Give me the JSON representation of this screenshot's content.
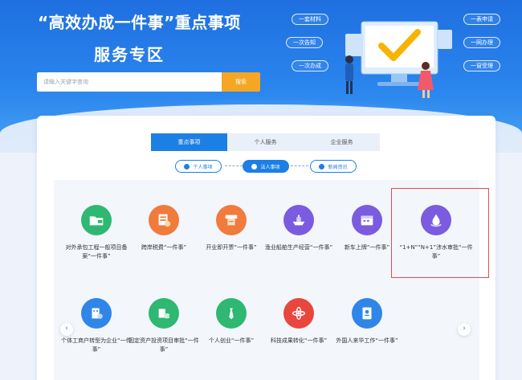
{
  "banner": {
    "title_line1": "“高效办成一件事”重点事项",
    "title_line2": "服务专区",
    "tags": [
      "一套材料",
      "一次告知",
      "一次办成",
      "一表申请",
      "一网办理",
      "一窗受理"
    ]
  },
  "search": {
    "placeholder": "请输入关键字查询",
    "button_label": "搜索"
  },
  "tabs": [
    "重点事项",
    "个人服务",
    "企业服务"
  ],
  "sub_filters": [
    "个人事项",
    "法人事项",
    "新闻资讯"
  ],
  "items": [
    {
      "label": "对外承包工程一般项目备案“一件事”",
      "color": "#2eb872",
      "icon": "folder-icon"
    },
    {
      "label": "跨岸税费“一件事”",
      "color": "#f07b3c",
      "icon": "tax-icon"
    },
    {
      "label": "开业即开票“一件事”",
      "color": "#f07b3c",
      "icon": "receipt-icon"
    },
    {
      "label": "渔业船舶生产经营“一件事”",
      "color": "#7b5be0",
      "icon": "ship-icon"
    },
    {
      "label": "新车上牌“一件事”",
      "color": "#7b5be0",
      "icon": "calendar-icon"
    },
    {
      "label": "“1+N”“N+1”涉水审批“一件事”",
      "color": "#7b5be0",
      "icon": "water-drop-icon"
    },
    {
      "label": "个体工商户转型为企业“一件事”",
      "color": "#2f86e8",
      "icon": "building-icon"
    },
    {
      "label": "固定资产投资项目审批“一件事”",
      "color": "#2eb872",
      "icon": "coins-icon"
    },
    {
      "label": "个人创业“一件事”",
      "color": "#2eb872",
      "icon": "tie-icon"
    },
    {
      "label": "科技成果转化“一件事”",
      "color": "#e8473e",
      "icon": "atom-icon"
    },
    {
      "label": "外国人来华工作“一件事”",
      "color": "#2f86e8",
      "icon": "id-card-icon"
    }
  ],
  "nav": {
    "prev": "‹",
    "next": "›"
  }
}
